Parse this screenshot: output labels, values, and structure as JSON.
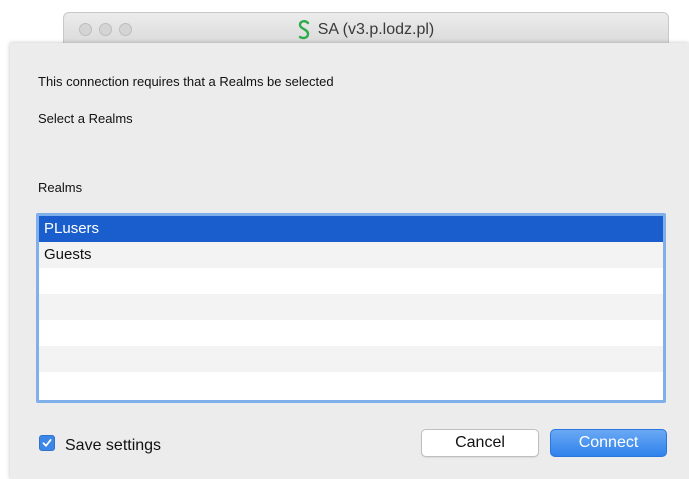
{
  "window": {
    "title": "SA (v3.p.lodz.pl)",
    "app_icon": "green-s-logo-icon",
    "controls": [
      "close-icon",
      "minimize-icon",
      "zoom-icon"
    ]
  },
  "dialog": {
    "message": "This connection requires that a Realms be selected",
    "prompt": "Select a Realms",
    "list_label": "Realms",
    "realms": [
      {
        "label": "PLusers",
        "selected": true
      },
      {
        "label": "Guests",
        "selected": false
      },
      {
        "label": "",
        "selected": false
      },
      {
        "label": "",
        "selected": false
      },
      {
        "label": "",
        "selected": false
      },
      {
        "label": "",
        "selected": false
      },
      {
        "label": "",
        "selected": false
      }
    ],
    "save_settings": {
      "label": "Save settings",
      "checked": true
    },
    "cancel_label": "Cancel",
    "connect_label": "Connect"
  },
  "colors": {
    "selection": "#1a5ecd",
    "accent": "#2f82ec",
    "focus_ring": "#7fb0ea",
    "logo_green": "#2daa4a"
  }
}
